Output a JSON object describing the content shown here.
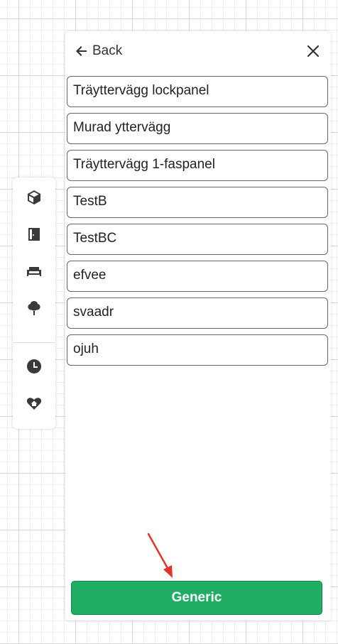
{
  "header": {
    "back_label": "Back",
    "back_icon": "arrow-left-icon",
    "close_icon": "close-icon"
  },
  "items": [
    {
      "label": "Träyttervägg lockpanel"
    },
    {
      "label": "Murad yttervägg"
    },
    {
      "label": "Träyttervägg 1-faspanel"
    },
    {
      "label": "TestB"
    },
    {
      "label": "TestBC"
    },
    {
      "label": "efvee"
    },
    {
      "label": "svaadr"
    },
    {
      "label": "ojuh"
    }
  ],
  "rail": {
    "tools": [
      "cube-icon",
      "door-icon",
      "sofa-icon",
      "tree-icon",
      "clock-icon",
      "heart-home-icon"
    ]
  },
  "generic_button": {
    "label": "Generic"
  },
  "colors": {
    "accent": "#1ead63",
    "annotation": "#e8302a"
  }
}
